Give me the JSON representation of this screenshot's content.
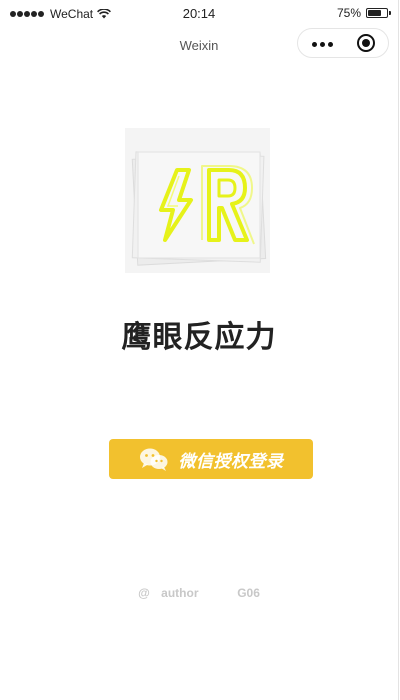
{
  "status_bar": {
    "carrier": "WeChat",
    "time": "20:14",
    "battery": "75%",
    "battery_level": 0.75
  },
  "nav": {
    "title": "Weixin"
  },
  "app": {
    "name": "鹰眼反应力"
  },
  "login": {
    "label": "微信授权登录"
  },
  "footer": {
    "at": "@",
    "author": "author",
    "code": "G06"
  },
  "colors": {
    "accent": "#f2c12e",
    "logo_neon": "#e6f21a"
  }
}
